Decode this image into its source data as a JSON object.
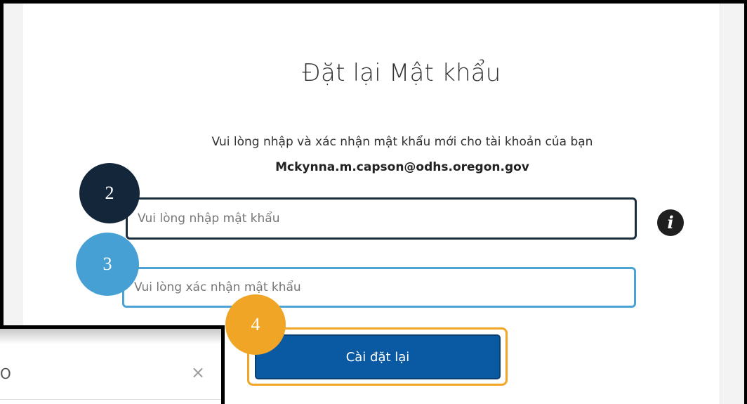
{
  "form": {
    "title": "Đặt lại Mật khẩu",
    "instruction": "Vui lòng nhập và xác nhận mật khẩu mới cho tài khoản của bạn",
    "email": "Mckynna.m.capson@odhs.oregon.gov",
    "password_placeholder": "Vui lòng nhập mật khẩu",
    "confirm_placeholder": "Vui lòng xác nhận mật khẩu",
    "submit_label": "Cài đặt lại",
    "info_icon": "info-icon"
  },
  "callouts": {
    "step_2": "2",
    "step_3": "3",
    "step_4": "4",
    "colors": {
      "step_2": "#14273a",
      "step_3": "#46a0d4",
      "step_4": "#f0a526"
    }
  },
  "dialog": {
    "title_fragment": "O",
    "close_glyph": "×"
  },
  "colors": {
    "button": "#0a5aa3",
    "text": "#333333"
  }
}
